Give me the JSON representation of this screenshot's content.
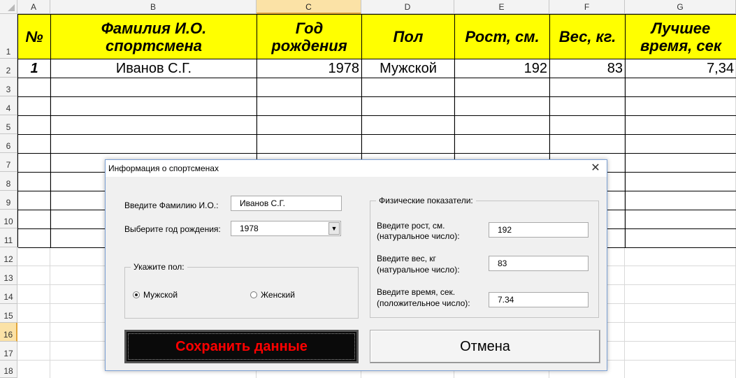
{
  "columns": [
    "A",
    "B",
    "C",
    "D",
    "E",
    "F",
    "G"
  ],
  "rows": [
    "1",
    "2",
    "3",
    "4",
    "5",
    "6",
    "7",
    "8",
    "9",
    "10",
    "11",
    "12",
    "13",
    "14",
    "15",
    "16",
    "17",
    "18"
  ],
  "table": {
    "headers": [
      "№",
      "Фамилия И.О. спортсмена",
      "Год рождения",
      "Пол",
      "Рост, см.",
      "Вес, кг.",
      "Лучшее время, сек"
    ],
    "row2": [
      "1",
      "Иванов С.Г.",
      "1978",
      "Мужской",
      "192",
      "83",
      "7,34"
    ]
  },
  "colors": {
    "header_fill": "#ffff00",
    "save_bg": "#0a0a0a",
    "save_text": "#ff0000"
  },
  "dialog": {
    "title": "Информация о спортсменах",
    "close_icon": "close-icon",
    "name_label": "Введите Фамилию И.О.:",
    "name_value": "Иванов С.Г.",
    "year_label": "Выберите год рождения:",
    "year_value": "1978",
    "gender_frame": "Укажите пол:",
    "male": "Мужской",
    "female": "Женский",
    "physical_frame": "Физические показатели:",
    "height_label_1": "Введите рост, см.",
    "height_label_2": "(натуральное число):",
    "height_value": "192",
    "weight_label_1": "Введите вес, кг",
    "weight_label_2": "(натуральное число):",
    "weight_value": "83",
    "time_label_1": "Введите время, сек.",
    "time_label_2": "(положительное число):",
    "time_value": "7.34",
    "save_label": "Сохранить данные",
    "cancel_label": "Отмена"
  }
}
